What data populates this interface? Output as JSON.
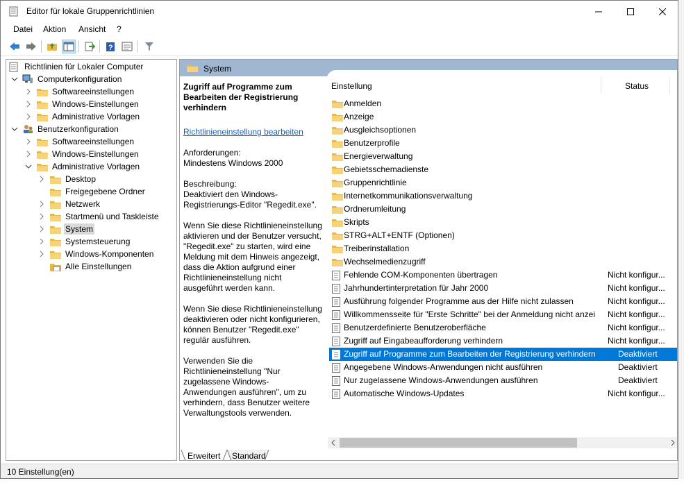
{
  "window": {
    "title": "Editor für lokale Gruppenrichtlinien"
  },
  "menu": [
    "Datei",
    "Aktion",
    "Ansicht",
    "?"
  ],
  "tree": {
    "root": "Richtlinien für Lokaler Computer",
    "computer": "Computerkonfiguration",
    "computer_children": [
      "Softwareeinstellungen",
      "Windows-Einstellungen",
      "Administrative Vorlagen"
    ],
    "user": "Benutzerkonfiguration",
    "user_children": [
      "Softwareeinstellungen",
      "Windows-Einstellungen",
      "Administrative Vorlagen"
    ],
    "admin_templates": [
      "Desktop",
      "Freigegebene Ordner",
      "Netzwerk",
      "Startmenü und Taskleiste",
      "System",
      "Systemsteuerung",
      "Windows-Komponenten",
      "Alle Einstellungen"
    ]
  },
  "header": {
    "title": "System"
  },
  "description": {
    "heading": "Zugriff auf Programme zum Bearbeiten der Registrierung verhindern",
    "edit_link": "Richtlinieneinstellung bearbeiten",
    "requirements_label": "Anforderungen:",
    "requirements_value": "Mindestens Windows 2000",
    "description_label": "Beschreibung:",
    "description_text": "Deaktiviert den Windows-Registrierungs-Editor \"Regedit.exe\".",
    "para1": "Wenn Sie diese Richtlinieneinstellung aktivieren und der Benutzer versucht, \"Regedit.exe\" zu starten, wird eine Meldung mit dem Hinweis angezeigt, dass die Aktion aufgrund einer Richtlinieneinstellung nicht ausgeführt werden kann.",
    "para2": "Wenn Sie diese Richtlinieneinstellung deaktivieren oder nicht konfigurieren, können Benutzer \"Regedit.exe\" regulär ausführen.",
    "para3": "Verwenden Sie die Richtlinieneinstellung \"Nur zugelassene Windows-Anwendungen ausführen\", um zu verhindern, dass Benutzer weitere Verwaltungstools verwenden."
  },
  "list": {
    "col_setting": "Einstellung",
    "col_status": "Status",
    "folders": [
      "Anmelden",
      "Anzeige",
      "Ausgleichsoptionen",
      "Benutzerprofile",
      "Energieverwaltung",
      "Gebietsschemadienste",
      "Gruppenrichtlinie",
      "Internetkommunikationsverwaltung",
      "Ordnerumleitung",
      "Skripts",
      "STRG+ALT+ENTF (Optionen)",
      "Treiberinstallation",
      "Wechselmedienzugriff"
    ],
    "policies": [
      {
        "name": "Fehlende COM-Komponenten übertragen",
        "status": "Nicht konfigur..."
      },
      {
        "name": "Jahrhundertinterpretation für Jahr 2000",
        "status": "Nicht konfigur..."
      },
      {
        "name": "Ausführung folgender Programme aus der Hilfe nicht zulassen",
        "status": "Nicht konfigur..."
      },
      {
        "name": "Willkommensseite für \"Erste Schritte\" bei der Anmeldung nicht anzei",
        "status": "Nicht konfigur..."
      },
      {
        "name": "Benutzerdefinierte Benutzeroberfläche",
        "status": "Nicht konfigur..."
      },
      {
        "name": "Zugriff auf Eingabeaufforderung verhindern",
        "status": "Nicht konfigur..."
      },
      {
        "name": "Zugriff auf Programme zum Bearbeiten der Registrierung verhindern",
        "status": "Deaktiviert"
      },
      {
        "name": "Angegebene Windows-Anwendungen nicht ausführen",
        "status": "Deaktiviert"
      },
      {
        "name": "Nur zugelassene Windows-Anwendungen ausführen",
        "status": "Deaktiviert"
      },
      {
        "name": "Automatische Windows-Updates",
        "status": "Nicht konfigur..."
      }
    ]
  },
  "tabs": [
    "Erweitert",
    "Standard"
  ],
  "status_bar": "10 Einstellung(en)",
  "colors": {
    "selection": "#0078d7",
    "header_band": "#9fb7d3",
    "folder": "#e8b84a",
    "link": "#1a5fb4"
  }
}
